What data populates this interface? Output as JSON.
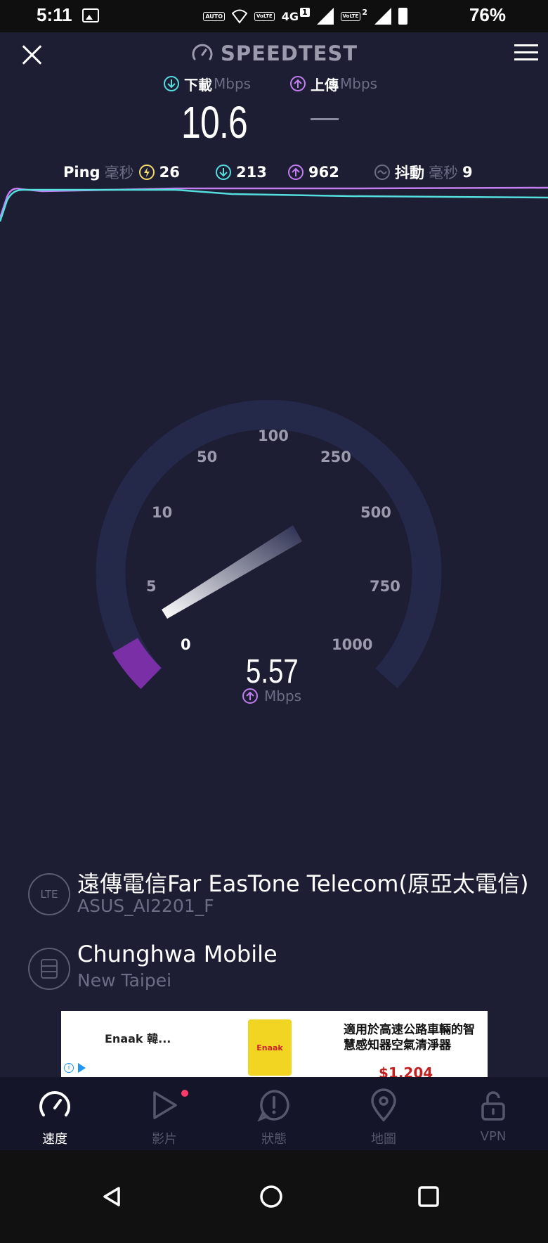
{
  "status_bar": {
    "time": "5:11",
    "network": "4G",
    "sim1": "1",
    "sim2": "2",
    "auto_label": "AUTO",
    "vo_label": "VoLTE",
    "battery_percent": "76%"
  },
  "header": {
    "title": "SPEEDTEST"
  },
  "download": {
    "label": "下載",
    "unit": "Mbps",
    "value": "10.6"
  },
  "upload": {
    "label": "上傳",
    "unit": "Mbps",
    "value": "—"
  },
  "stats": {
    "ping_label": "Ping",
    "ping_unit": "毫秒",
    "ping_idle": "26",
    "ping_download": "213",
    "ping_upload": "962",
    "jitter_label": "抖動",
    "jitter_unit": "毫秒",
    "jitter_value": "9"
  },
  "colors": {
    "background": "#1d1d33",
    "download_accent": "#55dede",
    "upload_accent": "#c27ef0",
    "gauge_fill": "#7a2fa6",
    "gauge_track": "#24294a"
  },
  "gauge": {
    "ticks": [
      "0",
      "5",
      "10",
      "50",
      "100",
      "250",
      "500",
      "750",
      "1000"
    ],
    "current_value": "5.57",
    "unit": "Mbps",
    "progress_fraction": 0.085
  },
  "providers": [
    {
      "icon_label": "LTE",
      "name": "遠傳電信Far EasTone Telecom(原亞太電信)",
      "sub": "ASUS_AI2201_F"
    },
    {
      "icon_label": "",
      "name": "Chunghwa Mobile",
      "sub": "New Taipei"
    }
  ],
  "ad": {
    "left_title": "Enaak 韓...",
    "product_label": "Enaak",
    "right_title": "適用於高速公路車輛的智慧感知器空氣清淨器",
    "price": "$1,204"
  },
  "bottom_nav": [
    {
      "label": "速度",
      "icon": "speedometer-icon",
      "active": true
    },
    {
      "label": "影片",
      "icon": "play-icon",
      "active": false
    },
    {
      "label": "狀態",
      "icon": "alert-icon",
      "active": false
    },
    {
      "label": "地圖",
      "icon": "map-pin-icon",
      "active": false
    },
    {
      "label": "VPN",
      "icon": "unlock-icon",
      "active": false
    }
  ]
}
